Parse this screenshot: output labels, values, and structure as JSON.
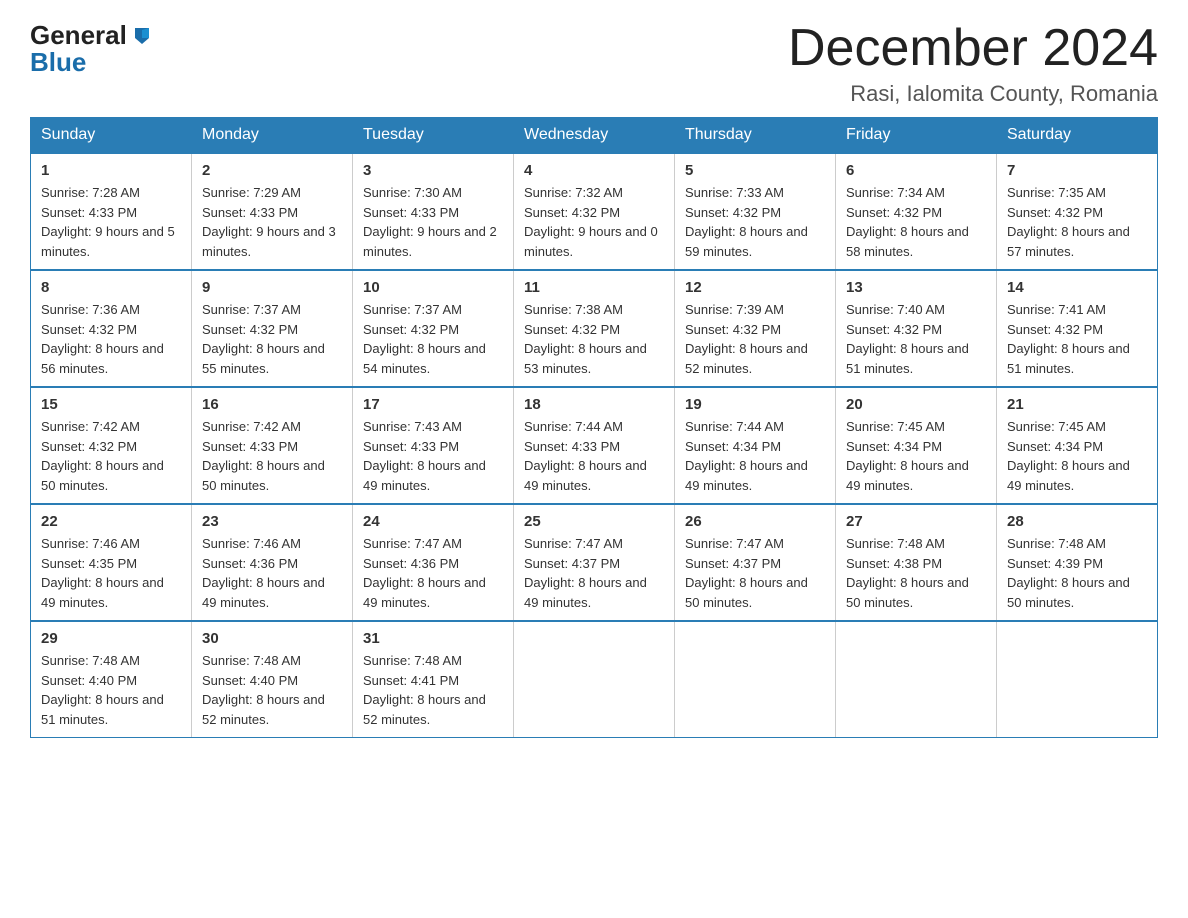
{
  "logo": {
    "line1": "General",
    "line2": "Blue"
  },
  "title": {
    "month": "December 2024",
    "location": "Rasi, Ialomita County, Romania"
  },
  "days_of_week": [
    "Sunday",
    "Monday",
    "Tuesday",
    "Wednesday",
    "Thursday",
    "Friday",
    "Saturday"
  ],
  "weeks": [
    [
      {
        "day": "1",
        "sunrise": "7:28 AM",
        "sunset": "4:33 PM",
        "daylight": "9 hours and 5 minutes."
      },
      {
        "day": "2",
        "sunrise": "7:29 AM",
        "sunset": "4:33 PM",
        "daylight": "9 hours and 3 minutes."
      },
      {
        "day": "3",
        "sunrise": "7:30 AM",
        "sunset": "4:33 PM",
        "daylight": "9 hours and 2 minutes."
      },
      {
        "day": "4",
        "sunrise": "7:32 AM",
        "sunset": "4:32 PM",
        "daylight": "9 hours and 0 minutes."
      },
      {
        "day": "5",
        "sunrise": "7:33 AM",
        "sunset": "4:32 PM",
        "daylight": "8 hours and 59 minutes."
      },
      {
        "day": "6",
        "sunrise": "7:34 AM",
        "sunset": "4:32 PM",
        "daylight": "8 hours and 58 minutes."
      },
      {
        "day": "7",
        "sunrise": "7:35 AM",
        "sunset": "4:32 PM",
        "daylight": "8 hours and 57 minutes."
      }
    ],
    [
      {
        "day": "8",
        "sunrise": "7:36 AM",
        "sunset": "4:32 PM",
        "daylight": "8 hours and 56 minutes."
      },
      {
        "day": "9",
        "sunrise": "7:37 AM",
        "sunset": "4:32 PM",
        "daylight": "8 hours and 55 minutes."
      },
      {
        "day": "10",
        "sunrise": "7:37 AM",
        "sunset": "4:32 PM",
        "daylight": "8 hours and 54 minutes."
      },
      {
        "day": "11",
        "sunrise": "7:38 AM",
        "sunset": "4:32 PM",
        "daylight": "8 hours and 53 minutes."
      },
      {
        "day": "12",
        "sunrise": "7:39 AM",
        "sunset": "4:32 PM",
        "daylight": "8 hours and 52 minutes."
      },
      {
        "day": "13",
        "sunrise": "7:40 AM",
        "sunset": "4:32 PM",
        "daylight": "8 hours and 51 minutes."
      },
      {
        "day": "14",
        "sunrise": "7:41 AM",
        "sunset": "4:32 PM",
        "daylight": "8 hours and 51 minutes."
      }
    ],
    [
      {
        "day": "15",
        "sunrise": "7:42 AM",
        "sunset": "4:32 PM",
        "daylight": "8 hours and 50 minutes."
      },
      {
        "day": "16",
        "sunrise": "7:42 AM",
        "sunset": "4:33 PM",
        "daylight": "8 hours and 50 minutes."
      },
      {
        "day": "17",
        "sunrise": "7:43 AM",
        "sunset": "4:33 PM",
        "daylight": "8 hours and 49 minutes."
      },
      {
        "day": "18",
        "sunrise": "7:44 AM",
        "sunset": "4:33 PM",
        "daylight": "8 hours and 49 minutes."
      },
      {
        "day": "19",
        "sunrise": "7:44 AM",
        "sunset": "4:34 PM",
        "daylight": "8 hours and 49 minutes."
      },
      {
        "day": "20",
        "sunrise": "7:45 AM",
        "sunset": "4:34 PM",
        "daylight": "8 hours and 49 minutes."
      },
      {
        "day": "21",
        "sunrise": "7:45 AM",
        "sunset": "4:34 PM",
        "daylight": "8 hours and 49 minutes."
      }
    ],
    [
      {
        "day": "22",
        "sunrise": "7:46 AM",
        "sunset": "4:35 PM",
        "daylight": "8 hours and 49 minutes."
      },
      {
        "day": "23",
        "sunrise": "7:46 AM",
        "sunset": "4:36 PM",
        "daylight": "8 hours and 49 minutes."
      },
      {
        "day": "24",
        "sunrise": "7:47 AM",
        "sunset": "4:36 PM",
        "daylight": "8 hours and 49 minutes."
      },
      {
        "day": "25",
        "sunrise": "7:47 AM",
        "sunset": "4:37 PM",
        "daylight": "8 hours and 49 minutes."
      },
      {
        "day": "26",
        "sunrise": "7:47 AM",
        "sunset": "4:37 PM",
        "daylight": "8 hours and 50 minutes."
      },
      {
        "day": "27",
        "sunrise": "7:48 AM",
        "sunset": "4:38 PM",
        "daylight": "8 hours and 50 minutes."
      },
      {
        "day": "28",
        "sunrise": "7:48 AM",
        "sunset": "4:39 PM",
        "daylight": "8 hours and 50 minutes."
      }
    ],
    [
      {
        "day": "29",
        "sunrise": "7:48 AM",
        "sunset": "4:40 PM",
        "daylight": "8 hours and 51 minutes."
      },
      {
        "day": "30",
        "sunrise": "7:48 AM",
        "sunset": "4:40 PM",
        "daylight": "8 hours and 52 minutes."
      },
      {
        "day": "31",
        "sunrise": "7:48 AM",
        "sunset": "4:41 PM",
        "daylight": "8 hours and 52 minutes."
      },
      null,
      null,
      null,
      null
    ]
  ],
  "labels": {
    "sunrise": "Sunrise:",
    "sunset": "Sunset:",
    "daylight": "Daylight:"
  }
}
